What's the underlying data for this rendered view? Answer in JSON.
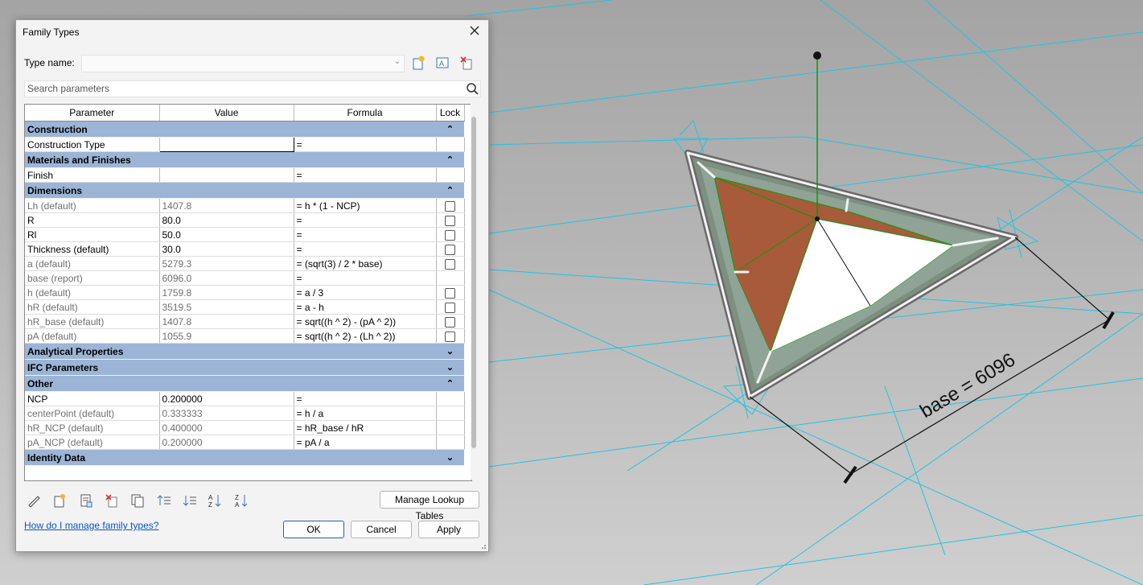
{
  "dialog": {
    "title": "Family Types",
    "type_name_label": "Type name:",
    "type_name_value": "",
    "search_placeholder": "Search parameters",
    "columns": [
      "Parameter",
      "Value",
      "Formula",
      "Lock"
    ],
    "groups": [
      {
        "name": "Construction",
        "expanded": true,
        "rows": [
          {
            "param": "Construction Type",
            "value": "",
            "formula": "=",
            "lock": null,
            "greyed": false
          }
        ]
      },
      {
        "name": "Materials and Finishes",
        "expanded": true,
        "rows": [
          {
            "param": "Finish",
            "value": "",
            "formula": "=",
            "lock": null,
            "greyed": false
          }
        ]
      },
      {
        "name": "Dimensions",
        "expanded": true,
        "rows": [
          {
            "param": "Lh (default)",
            "value": "1407.8",
            "formula": "= h * (1 - NCP)",
            "lock": false,
            "greyed": true
          },
          {
            "param": "R",
            "value": "80.0",
            "formula": "=",
            "lock": false,
            "greyed": false
          },
          {
            "param": "Rl",
            "value": "50.0",
            "formula": "=",
            "lock": false,
            "greyed": false
          },
          {
            "param": "Thickness (default)",
            "value": "30.0",
            "formula": "=",
            "lock": false,
            "greyed": false
          },
          {
            "param": "a (default)",
            "value": "5279.3",
            "formula": "= (sqrt(3) / 2 * base)",
            "lock": false,
            "greyed": true
          },
          {
            "param": "base (report)",
            "value": "6096.0",
            "formula": "=",
            "lock": null,
            "greyed": true
          },
          {
            "param": "h (default)",
            "value": "1759.8",
            "formula": "= a / 3",
            "lock": false,
            "greyed": true
          },
          {
            "param": "hR (default)",
            "value": "3519.5",
            "formula": "= a - h",
            "lock": false,
            "greyed": true
          },
          {
            "param": "hR_base (default)",
            "value": "1407.8",
            "formula": "= sqrt((h ^ 2) - (pA ^ 2))",
            "lock": false,
            "greyed": true
          },
          {
            "param": "pA (default)",
            "value": "1055.9",
            "formula": "= sqrt((h ^ 2) - (Lh ^ 2))",
            "lock": false,
            "greyed": true
          }
        ]
      },
      {
        "name": "Analytical Properties",
        "expanded": false,
        "rows": []
      },
      {
        "name": "IFC Parameters",
        "expanded": false,
        "rows": []
      },
      {
        "name": "Other",
        "expanded": true,
        "rows": [
          {
            "param": "NCP",
            "value": "0.200000",
            "formula": "=",
            "lock": null,
            "greyed": false
          },
          {
            "param": "centerPoint (default)",
            "value": "0.333333",
            "formula": "= h / a",
            "lock": null,
            "greyed": true
          },
          {
            "param": "hR_NCP (default)",
            "value": "0.400000",
            "formula": "= hR_base / hR",
            "lock": null,
            "greyed": true
          },
          {
            "param": "pA_NCP (default)",
            "value": "0.200000",
            "formula": "= pA / a",
            "lock": null,
            "greyed": true
          }
        ]
      },
      {
        "name": "Identity Data",
        "expanded": false,
        "rows": []
      }
    ],
    "manage_lookup_label": "Manage Lookup Tables",
    "help_link": "How do I manage family types?",
    "ok_label": "OK",
    "cancel_label": "Cancel",
    "apply_label": "Apply"
  },
  "model": {
    "dimension_label": "base = 6096"
  },
  "colors": {
    "group_header": "#9cb5d6",
    "ref_plane": "#22c4e0",
    "material_brown": "#a75b3a",
    "green_axis": "#0a9a0a"
  }
}
